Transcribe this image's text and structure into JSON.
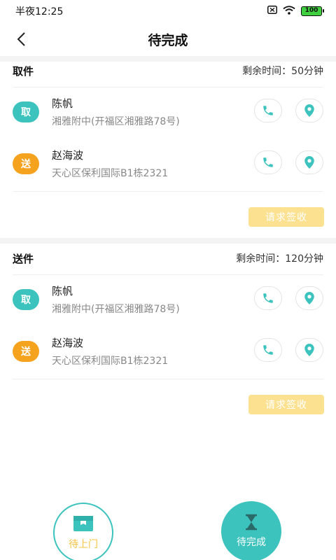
{
  "status_bar": {
    "time": "半夜12:25",
    "battery": "100"
  },
  "nav": {
    "title": "待完成"
  },
  "sections": [
    {
      "title": "取件",
      "time_left": "剩余时间：50分钟",
      "contacts": [
        {
          "badge": "取",
          "name": "陈帆",
          "address": "湘雅附中(开福区湘雅路78号)"
        },
        {
          "badge": "送",
          "name": "赵海波",
          "address": "天心区保利国际B1栋2321"
        }
      ],
      "action_label": "请求签收"
    },
    {
      "title": "送件",
      "time_left": "剩余时间：120分钟",
      "contacts": [
        {
          "badge": "取",
          "name": "陈帆",
          "address": "湘雅附中(开福区湘雅路78号)"
        },
        {
          "badge": "送",
          "name": "赵海波",
          "address": "天心区保利国际B1栋2321"
        }
      ],
      "action_label": "请求签收"
    }
  ],
  "tabs": [
    {
      "label": "待上门"
    },
    {
      "label": "待完成"
    }
  ],
  "colors": {
    "accent": "#3cc3be",
    "deliver": "#f5a31e",
    "action": "#fbe190"
  }
}
